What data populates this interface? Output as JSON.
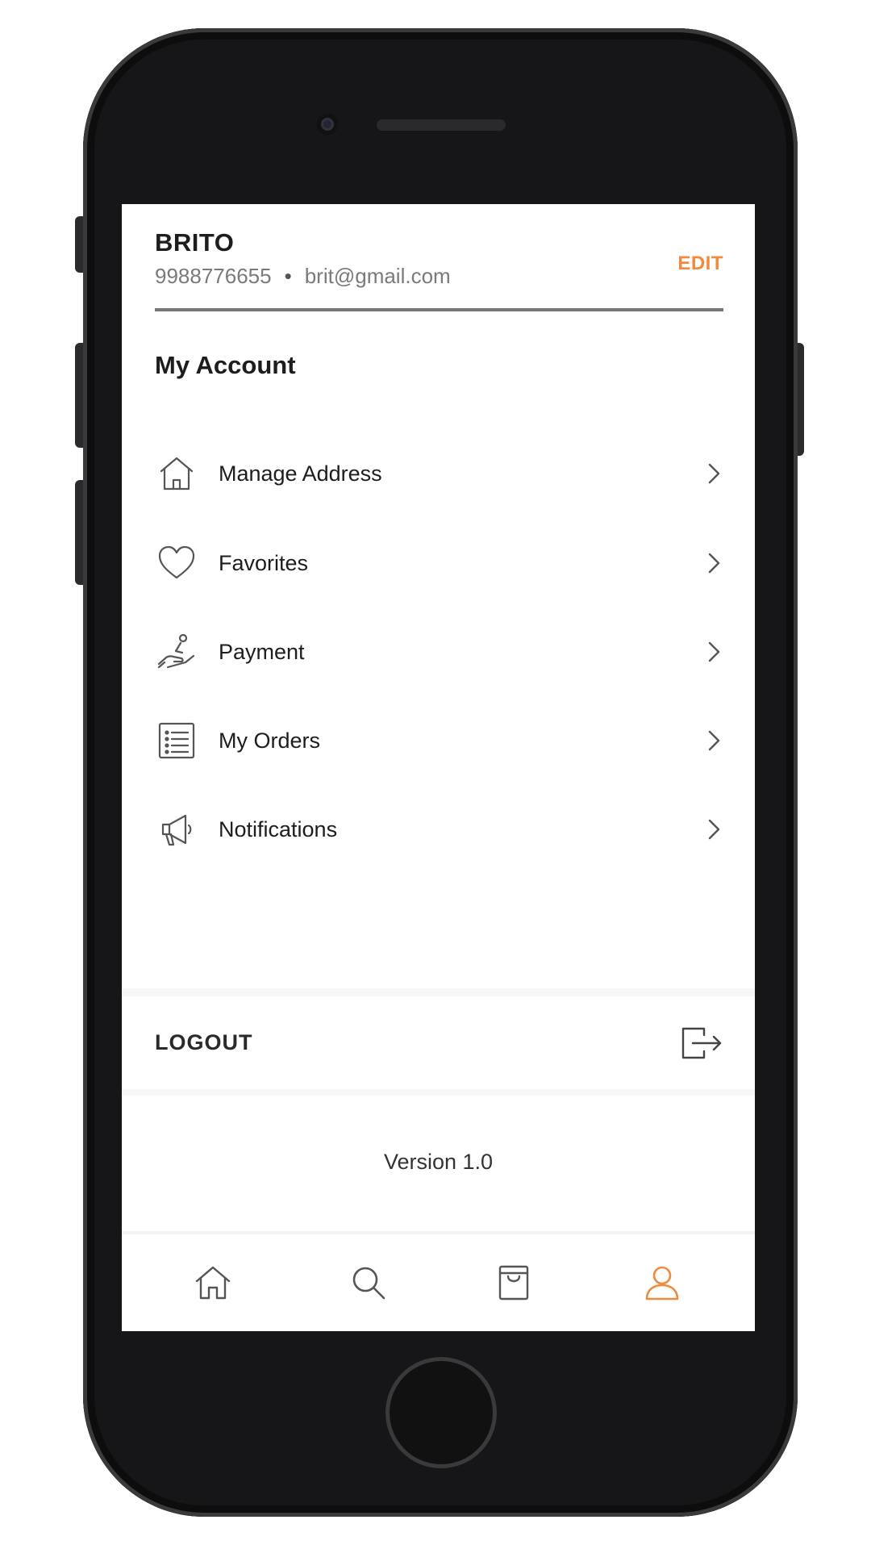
{
  "profile": {
    "name": "BRITO",
    "phone": "9988776655",
    "separator": "•",
    "email": "brit@gmail.com",
    "edit_label": "EDIT"
  },
  "section": {
    "title": "My Account"
  },
  "menu": {
    "items": [
      {
        "label": "Manage Address",
        "icon": "house-icon"
      },
      {
        "label": "Favorites",
        "icon": "heart-icon"
      },
      {
        "label": "Payment",
        "icon": "hand-payment-icon"
      },
      {
        "label": "My Orders",
        "icon": "order-list-icon"
      },
      {
        "label": "Notifications",
        "icon": "megaphone-icon"
      }
    ]
  },
  "logout": {
    "label": "LOGOUT",
    "icon": "logout-icon"
  },
  "footer": {
    "version": "Version 1.0"
  },
  "tabbar": {
    "tabs": [
      {
        "icon": "home-icon",
        "active": false
      },
      {
        "icon": "search-icon",
        "active": false
      },
      {
        "icon": "bag-icon",
        "active": false
      },
      {
        "icon": "profile-icon",
        "active": true
      }
    ]
  },
  "colors": {
    "accent": "#f08a3c",
    "text": "#1d1d1f",
    "muted": "#7a7a7a",
    "icon": "#555555"
  }
}
